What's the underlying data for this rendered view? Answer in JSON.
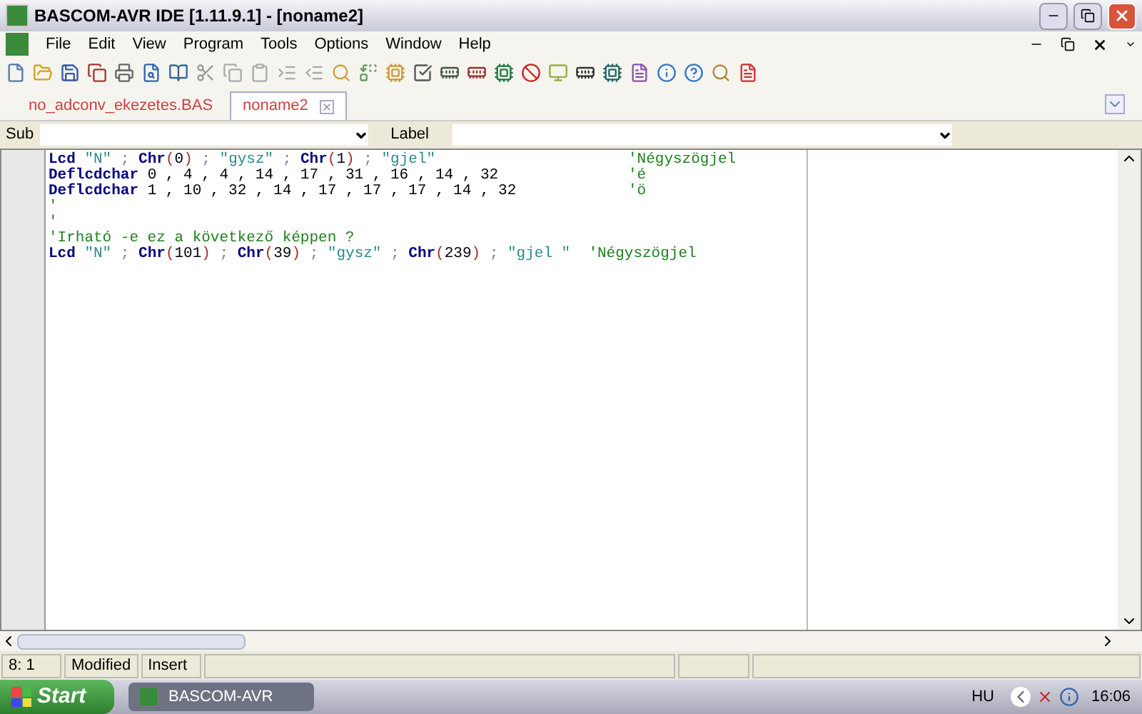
{
  "window": {
    "title": "BASCOM-AVR IDE [1.11.9.1] - [noname2]"
  },
  "menu": [
    "File",
    "Edit",
    "View",
    "Program",
    "Tools",
    "Options",
    "Window",
    "Help"
  ],
  "tabs": [
    {
      "label": "no_adconv_ekezetes.BAS",
      "selected": false
    },
    {
      "label": "noname2",
      "selected": true
    }
  ],
  "sub_label": "Sub",
  "label_label": "Label",
  "code": [
    {
      "tokens": [
        {
          "kind": "kw",
          "text": "Lcd"
        },
        {
          "kind": "str",
          "text": " \"N\""
        },
        {
          "kind": "op",
          "text": " ; "
        },
        {
          "kind": "kw",
          "text": "Chr"
        },
        {
          "kind": "paren",
          "text": "("
        },
        {
          "kind": "num",
          "text": "0"
        },
        {
          "kind": "paren",
          "text": ")"
        },
        {
          "kind": "op",
          "text": " ; "
        },
        {
          "kind": "str",
          "text": "\"gysz\""
        },
        {
          "kind": "op",
          "text": " ; "
        },
        {
          "kind": "kw",
          "text": "Chr"
        },
        {
          "kind": "paren",
          "text": "("
        },
        {
          "kind": "num",
          "text": "1"
        },
        {
          "kind": "paren",
          "text": ")"
        },
        {
          "kind": "op",
          "text": " ; "
        },
        {
          "kind": "str",
          "text": "\"gjel\""
        }
      ],
      "comment": "'Négyszögjel"
    },
    {
      "tokens": [
        {
          "kind": "kw",
          "text": "Deflcdchar"
        },
        {
          "kind": "num",
          "text": " 0 , 4 , 4 , 14 , 17 , 31 , 16 , 14 , 32"
        }
      ],
      "comment": "'é"
    },
    {
      "tokens": [
        {
          "kind": "kw",
          "text": "Deflcdchar"
        },
        {
          "kind": "num",
          "text": " 1 , 10 , 32 , 14 , 17 , 17 , 17 , 14 , 32"
        }
      ],
      "comment": "'ö"
    },
    {
      "tokens": [
        {
          "kind": "comment",
          "text": "'"
        }
      ]
    },
    {
      "tokens": [
        {
          "kind": "comment",
          "text": "'"
        }
      ]
    },
    {
      "tokens": [
        {
          "kind": "comment",
          "text": "'Irható -e ez a következő képpen ?"
        }
      ]
    },
    {
      "tokens": [
        {
          "kind": "kw",
          "text": "Lcd"
        },
        {
          "kind": "str",
          "text": " \"N\""
        },
        {
          "kind": "op",
          "text": " ; "
        },
        {
          "kind": "kw",
          "text": "Chr"
        },
        {
          "kind": "paren",
          "text": "("
        },
        {
          "kind": "num",
          "text": "101"
        },
        {
          "kind": "paren",
          "text": ")"
        },
        {
          "kind": "op",
          "text": " ; "
        },
        {
          "kind": "kw",
          "text": "Chr"
        },
        {
          "kind": "paren",
          "text": "("
        },
        {
          "kind": "num",
          "text": "39"
        },
        {
          "kind": "paren",
          "text": ")"
        },
        {
          "kind": "op",
          "text": " ; "
        },
        {
          "kind": "str",
          "text": "\"gysz\""
        },
        {
          "kind": "op",
          "text": " ; "
        },
        {
          "kind": "kw",
          "text": "Chr"
        },
        {
          "kind": "paren",
          "text": "("
        },
        {
          "kind": "num",
          "text": "239"
        },
        {
          "kind": "paren",
          "text": ")"
        },
        {
          "kind": "op",
          "text": " ; "
        },
        {
          "kind": "str",
          "text": "\"gjel \"  "
        },
        {
          "kind": "comment",
          "text": "'Négyszögjel"
        }
      ]
    }
  ],
  "status_bar": [
    "8: 1",
    "Modified",
    "Insert"
  ],
  "taskbar": {
    "start": "Start",
    "task": "BASCOM-AVR",
    "language": "HU",
    "clock": "16:06"
  }
}
